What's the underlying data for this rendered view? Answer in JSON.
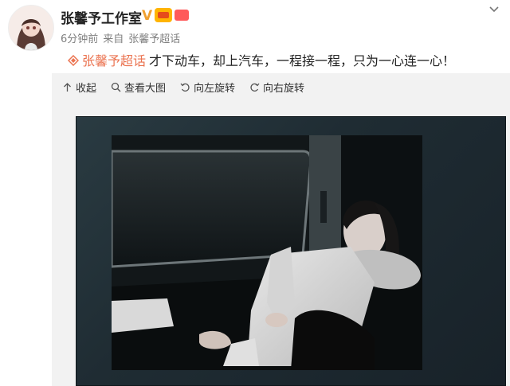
{
  "header": {
    "name": "张馨予工作室",
    "verified_mark": "V",
    "time": "6分钟前",
    "source_prefix": "来自",
    "source": "张馨予超话"
  },
  "post": {
    "topic": "张馨予超话",
    "text": "才下动车，却上汽车，一程接一程，只为一心连一心！"
  },
  "toolbar": {
    "collapse": "收起",
    "view_large": "查看大图",
    "rotate_left": "向左旋转",
    "rotate_right": "向右旋转"
  },
  "colors": {
    "accent": "#eb7350",
    "verified": "#f0a030",
    "muted": "#808080"
  },
  "icons": [
    "avatar",
    "vip-badge-icon",
    "fan-badge-icon",
    "chevron-down-icon",
    "topic-diamond-icon",
    "collapse-arrow-icon",
    "magnifier-icon",
    "rotate-left-icon",
    "rotate-right-icon"
  ]
}
